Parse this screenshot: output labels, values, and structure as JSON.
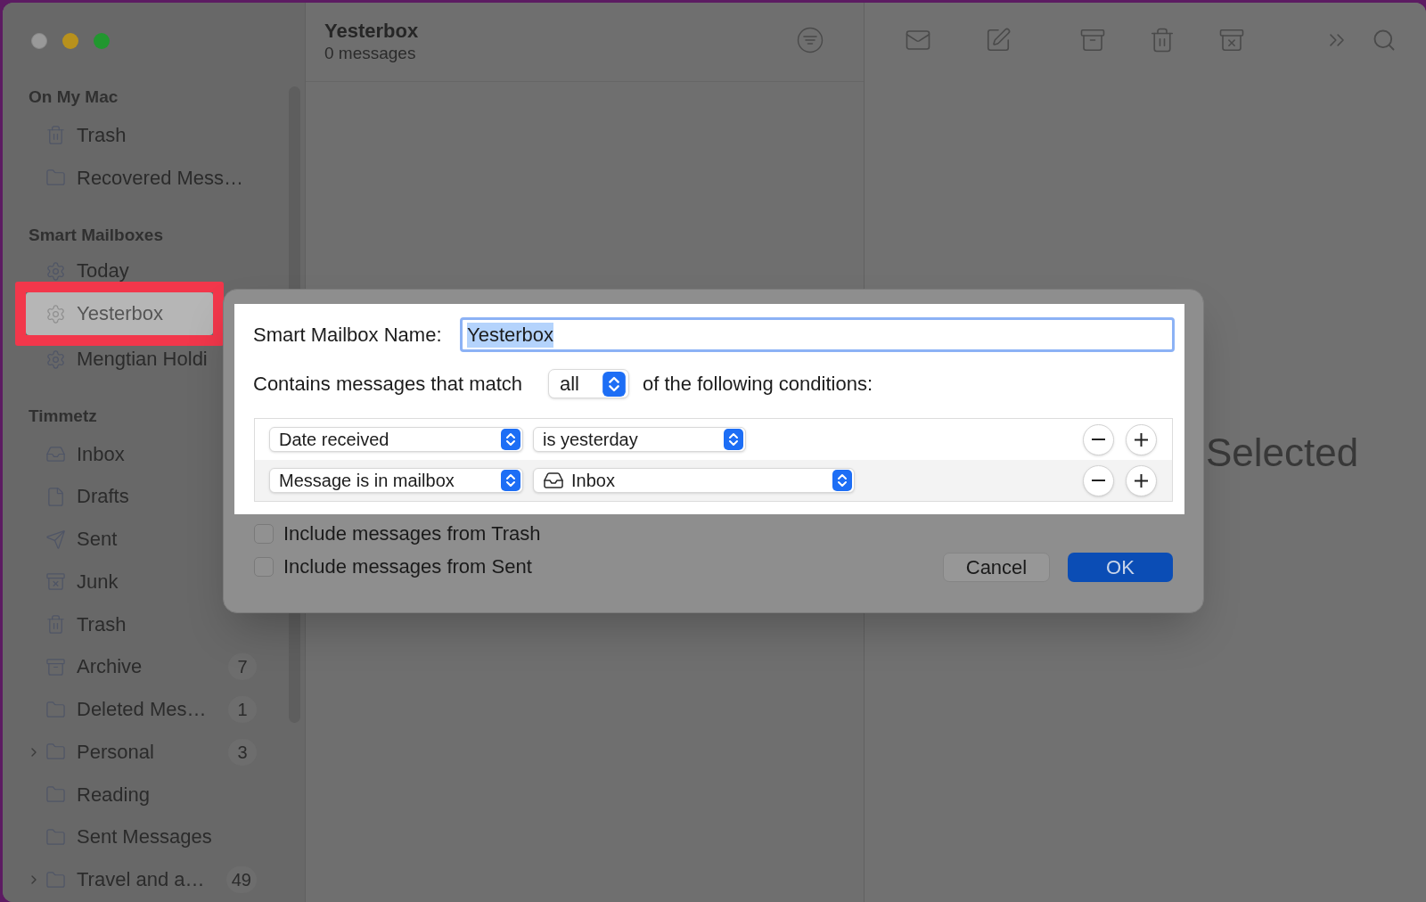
{
  "sidebar": {
    "sections": [
      {
        "title": "On My Mac",
        "items": [
          {
            "label": "Trash",
            "kind": "trash",
            "selected": false,
            "highlighted": false
          },
          {
            "label": "Recovered Mess…",
            "kind": "folder",
            "selected": false,
            "highlighted": false
          }
        ]
      },
      {
        "title": "Smart Mailboxes",
        "items": [
          {
            "label": "Today",
            "kind": "smart",
            "selected": false,
            "highlighted": false
          },
          {
            "label": "Yesterbox",
            "kind": "smart",
            "selected": true,
            "highlighted": true
          },
          {
            "label": "Mengtian Holdi",
            "kind": "smart",
            "selected": false,
            "highlighted": false
          }
        ]
      },
      {
        "title": "Timmetz",
        "items": [
          {
            "label": "Inbox",
            "kind": "inbox",
            "selected": false,
            "highlighted": false
          },
          {
            "label": "Drafts",
            "kind": "drafts",
            "selected": false,
            "highlighted": false
          },
          {
            "label": "Sent",
            "kind": "sent",
            "selected": false,
            "highlighted": false
          },
          {
            "label": "Junk",
            "kind": "junk",
            "selected": false,
            "highlighted": false
          },
          {
            "label": "Trash",
            "kind": "trash",
            "selected": false,
            "highlighted": false
          },
          {
            "label": "Archive",
            "kind": "archive",
            "selected": false,
            "highlighted": false,
            "count": "7"
          },
          {
            "label": "Deleted Mes…",
            "kind": "folder",
            "selected": false,
            "highlighted": false,
            "count": "1"
          },
          {
            "label": "Personal",
            "kind": "folder",
            "selected": false,
            "highlighted": false,
            "count": "3",
            "expanded": false
          },
          {
            "label": "Reading",
            "kind": "folder",
            "selected": false,
            "highlighted": false
          },
          {
            "label": "Sent Messages",
            "kind": "folder",
            "selected": false,
            "highlighted": false
          },
          {
            "label": "Travel and a…",
            "kind": "folder",
            "selected": false,
            "highlighted": false,
            "count": "49",
            "expanded": false
          }
        ]
      }
    ]
  },
  "message_list": {
    "title": "Yesterbox",
    "count": "0 messages"
  },
  "reading_pane": {
    "message": "Selected"
  },
  "dialog": {
    "name_label": "Smart Mailbox Name:",
    "name_field": {
      "value": "Yesterbox",
      "value_selected": true
    },
    "match_prefix": "Contains messages that match",
    "match_popup": "all",
    "match_suffix": "of the following conditions:",
    "conditions": [
      {
        "field": "Date received",
        "operator": "is yesterday",
        "kind": "plain"
      },
      {
        "field": "Message is in mailbox",
        "operator": "Inbox",
        "kind": "mailbox"
      }
    ],
    "options": [
      {
        "label": "Include messages from Trash",
        "checked": false
      },
      {
        "label": "Include messages from Sent",
        "checked": false
      }
    ],
    "buttons": [
      {
        "label": "Cancel",
        "kind": "secondary"
      },
      {
        "label": "OK",
        "kind": "primary"
      }
    ]
  }
}
